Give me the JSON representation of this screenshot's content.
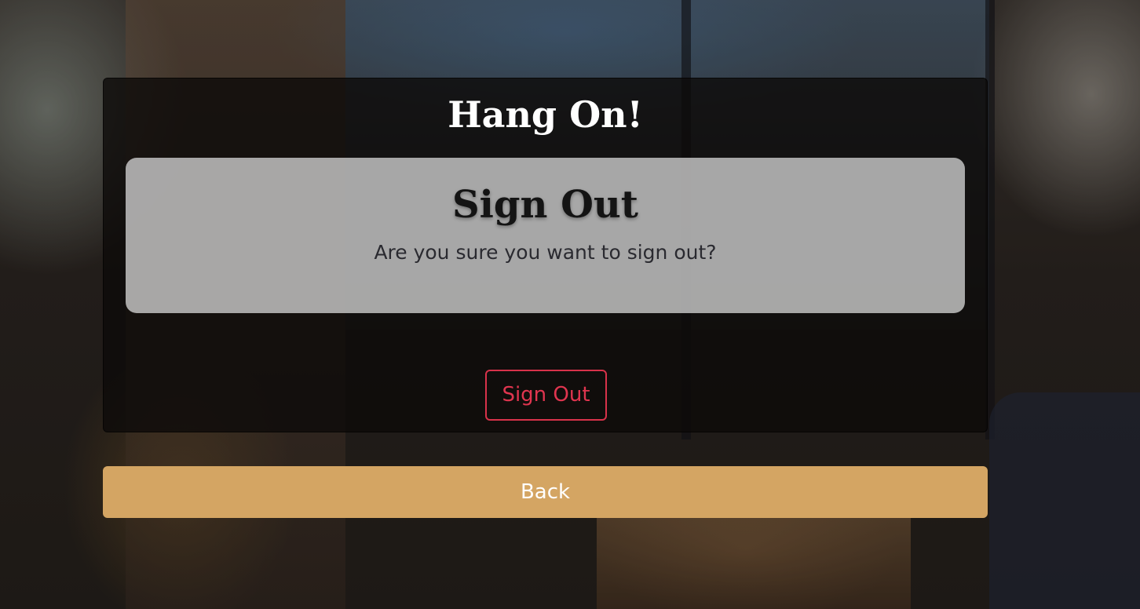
{
  "dialog": {
    "title": "Hang On!",
    "card": {
      "title": "Sign Out",
      "message": "Are you sure you want to sign out?"
    },
    "signout_label": "Sign Out"
  },
  "back_label": "Back",
  "colors": {
    "accent_danger": "#d8324a",
    "back_button": "#d4a563",
    "panel_bg": "#0c0a09",
    "card_bg": "#cdcdcd"
  }
}
